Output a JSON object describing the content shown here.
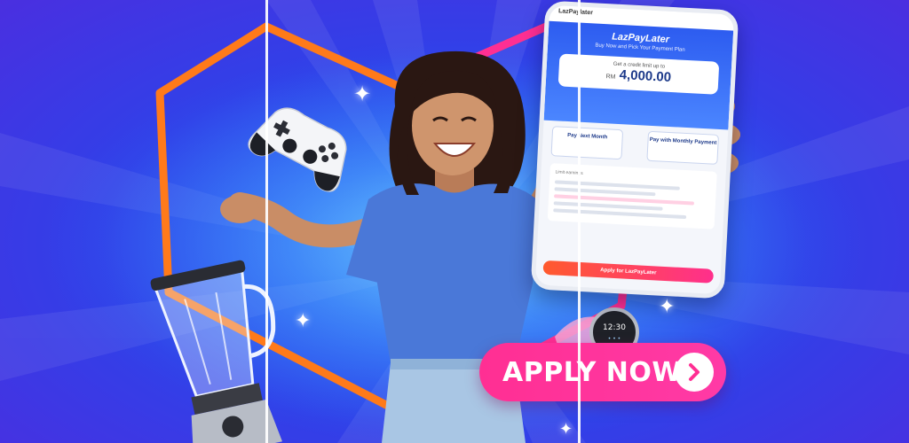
{
  "phone": {
    "topbar_title": "LazPaylater",
    "brand": "LazPayLater",
    "tagline": "Buy Now and Pick Your Payment Plan",
    "credit_caption": "Get a credit limit up to",
    "credit_currency": "RM",
    "credit_amount": "4,000.00",
    "plan_1": "Pay Next Month",
    "plan_2": "Pay with Monthly Payment",
    "section_title": "Limit earnings",
    "cta_label": "Apply for LazPayLater"
  },
  "cta": {
    "label": "APPLY NOW"
  },
  "colors": {
    "background_blue": "#3140e8",
    "hexagon_orange": "#ff7a1a",
    "hexagon_pink": "#ff2f93",
    "button_pink": "#ff2f93",
    "shirt_blue": "#4a78d8",
    "jeans_blue": "#a9c6e4"
  },
  "icons": [
    "game-controller-icon",
    "blender-icon",
    "smartwatch-icon",
    "sparkle-icon",
    "chevron-right-icon"
  ]
}
